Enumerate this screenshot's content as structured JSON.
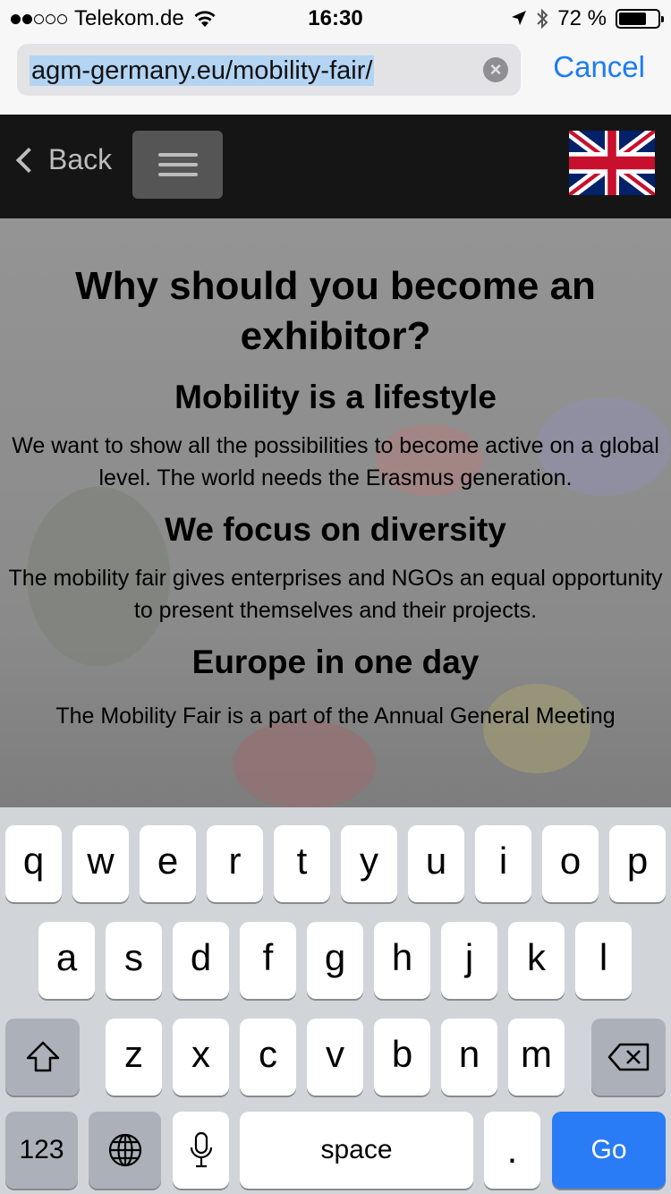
{
  "status_bar": {
    "carrier": "Telekom.de",
    "time": "16:30",
    "battery": "72 %",
    "battery_level": 0.72
  },
  "browser": {
    "url": "agm-germany.eu/mobility-fair/",
    "cancel_label": "Cancel"
  },
  "site_nav": {
    "back_label": "Back"
  },
  "content": {
    "title": "Why should you become an exhibitor?",
    "sections": [
      {
        "heading": "Mobility is a lifestyle",
        "text": "We want to show all the possibilities to become active on a global level. The world needs the Erasmus generation."
      },
      {
        "heading": "We focus on diversity",
        "text": "The mobility fair gives enterprises and NGOs an equal opportunity to present themselves and their projects."
      },
      {
        "heading": "Europe in one day",
        "text": "The Mobility Fair is a part of the Annual General Meeting"
      }
    ]
  },
  "keyboard": {
    "row1": [
      "q",
      "w",
      "e",
      "r",
      "t",
      "y",
      "u",
      "i",
      "o",
      "p"
    ],
    "row2": [
      "a",
      "s",
      "d",
      "f",
      "g",
      "h",
      "j",
      "k",
      "l"
    ],
    "row3": [
      "z",
      "x",
      "c",
      "v",
      "b",
      "n",
      "m"
    ],
    "numbers_label": "123",
    "space_label": "space",
    "period_label": ".",
    "go_label": "Go"
  }
}
